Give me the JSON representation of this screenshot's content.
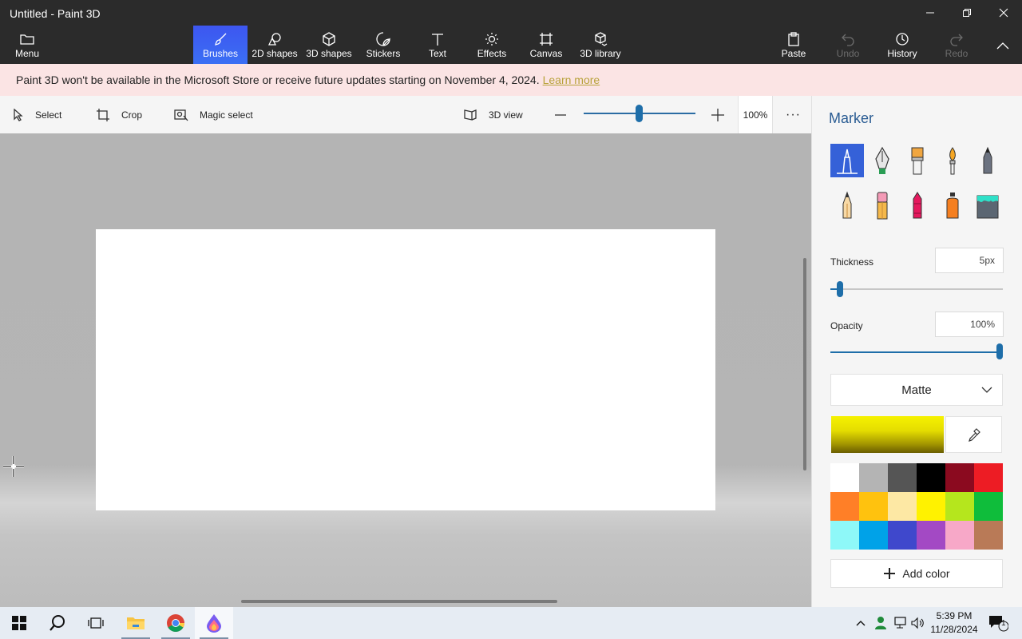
{
  "window": {
    "title": "Untitled - Paint 3D"
  },
  "ribbon": {
    "menu": "Menu",
    "tools": [
      {
        "id": "brushes",
        "label": "Brushes",
        "active": true
      },
      {
        "id": "shapes2d",
        "label": "2D shapes"
      },
      {
        "id": "shapes3d",
        "label": "3D shapes"
      },
      {
        "id": "stickers",
        "label": "Stickers"
      },
      {
        "id": "text",
        "label": "Text"
      },
      {
        "id": "effects",
        "label": "Effects"
      },
      {
        "id": "canvas",
        "label": "Canvas"
      },
      {
        "id": "library3d",
        "label": "3D library"
      }
    ],
    "paste": "Paste",
    "undo": "Undo",
    "history": "History",
    "redo": "Redo"
  },
  "banner": {
    "message": "Paint 3D won't be available in the Microsoft Store or receive future updates starting on November 4, 2024.",
    "link": "Learn more"
  },
  "toolbar": {
    "select": "Select",
    "crop": "Crop",
    "magic_select": "Magic select",
    "view3d": "3D view",
    "zoom": "100%",
    "more": "···"
  },
  "panel": {
    "title": "Marker",
    "thickness_label": "Thickness",
    "thickness_value": "5px",
    "opacity_label": "Opacity",
    "opacity_value": "100%",
    "finish": "Matte",
    "current_color": "#f2ee00",
    "add_color": "Add color",
    "palette": [
      "#ffffff",
      "#b4b4b4",
      "#555555",
      "#000000",
      "#8b0a1f",
      "#ed1c24",
      "#ff7f27",
      "#ffc20e",
      "#fde8a4",
      "#fff200",
      "#b5e61d",
      "#0fbd3b",
      "#8ef8f8",
      "#00a2e8",
      "#3f48cc",
      "#a349c4",
      "#f7a8c8",
      "#b97a57"
    ]
  },
  "taskbar": {
    "time": "5:39 PM",
    "date": "11/28/2024",
    "notifications": "1"
  },
  "colors": {
    "accent": "#3561d8",
    "slider": "#1e6ea9"
  }
}
